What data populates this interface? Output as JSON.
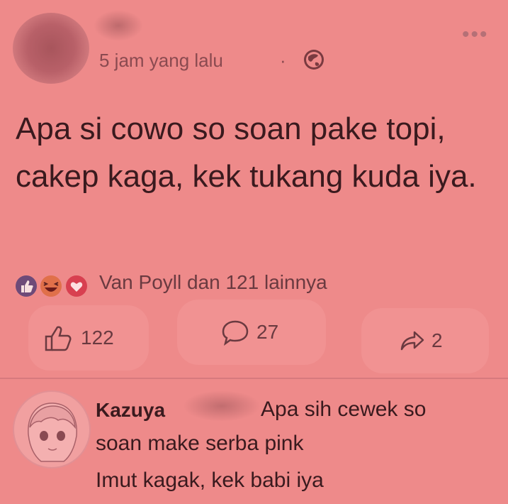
{
  "post": {
    "timestamp": "5 jam yang lalu",
    "separator": "·",
    "text": "Apa si cowo so soan pake topi, cakep kaga, kek tukang kuda iya.",
    "reaction_summary": "Van Poyll dan 121 lainnya",
    "reaction_icons": [
      "like-icon",
      "haha-icon",
      "love-icon"
    ]
  },
  "actions": {
    "likes": "122",
    "comments": "27",
    "shares": "2"
  },
  "comment": {
    "author": "Kazuya",
    "line1": "Apa sih cewek so",
    "line2": "soan make serba pink",
    "line3": "Imut kagak, kek babi iya"
  },
  "colors": {
    "background": "#ee8a8a",
    "text": "#3a1a1e",
    "meta_text": "#8a4a50"
  }
}
